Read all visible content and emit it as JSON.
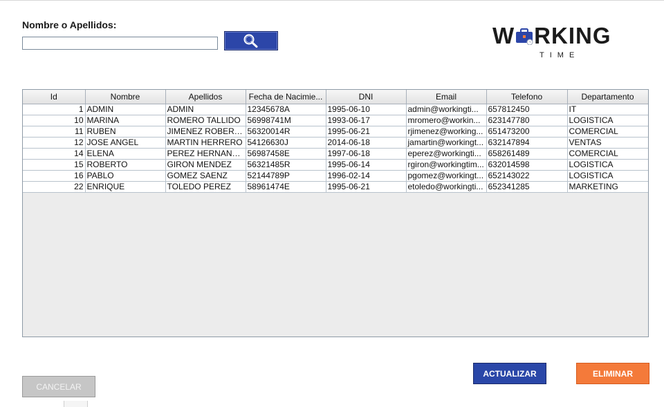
{
  "search": {
    "label": "Nombre o Apellidos:",
    "value": "",
    "button_icon": "search-icon"
  },
  "logo": {
    "word_left": "W",
    "word_right": "RKING",
    "subtitle": "TIME",
    "icon": "briefcase-clock-icon"
  },
  "table": {
    "columns": [
      "Id",
      "Nombre",
      "Apellidos",
      "Fecha de Nacimie...",
      "DNI",
      "Email",
      "Telefono",
      "Departamento"
    ],
    "rows": [
      [
        "1",
        "ADMIN",
        "ADMIN",
        "12345678A",
        "1995-06-10",
        "admin@workingti...",
        "657812450",
        "IT"
      ],
      [
        "10",
        "MARINA",
        "ROMERO TALLIDO",
        "56998741M",
        "1993-06-17",
        "mromero@workin...",
        "623147780",
        "LOGISTICA"
      ],
      [
        "11",
        "RUBEN",
        "JIMENEZ ROBERTO",
        "56320014R",
        "1995-06-21",
        "rjimenez@working...",
        "651473200",
        "COMERCIAL"
      ],
      [
        "12",
        "JOSE ANGEL",
        "MARTIN HERRERO",
        "54126630J",
        "2014-06-18",
        "jamartin@workingt...",
        "632147894",
        "VENTAS"
      ],
      [
        "14",
        "ELENA",
        "PEREZ HERNAND...",
        "56987458E",
        "1997-06-18",
        "eperez@workingti...",
        "658261489",
        "COMERCIAL"
      ],
      [
        "15",
        "ROBERTO",
        "GIRON MENDEZ",
        "56321485R",
        "1995-06-14",
        "rgiron@workingtim...",
        "632014598",
        "LOGISTICA"
      ],
      [
        "16",
        "PABLO",
        "GOMEZ SAENZ",
        "52144789P",
        "1996-02-14",
        "pgomez@workingt...",
        "652143022",
        "LOGISTICA"
      ],
      [
        "22",
        "ENRIQUE",
        "TOLEDO PEREZ",
        "58961474E",
        "1995-06-21",
        "etoledo@workingti...",
        "652341285",
        "MARKETING"
      ]
    ]
  },
  "buttons": {
    "update": "ACTUALIZAR",
    "delete": "ELIMINAR",
    "cancel": "CANCELAR"
  },
  "colors": {
    "primary": "#2a47a8",
    "danger": "#f47a3a",
    "disabled": "#c6c6c6"
  }
}
